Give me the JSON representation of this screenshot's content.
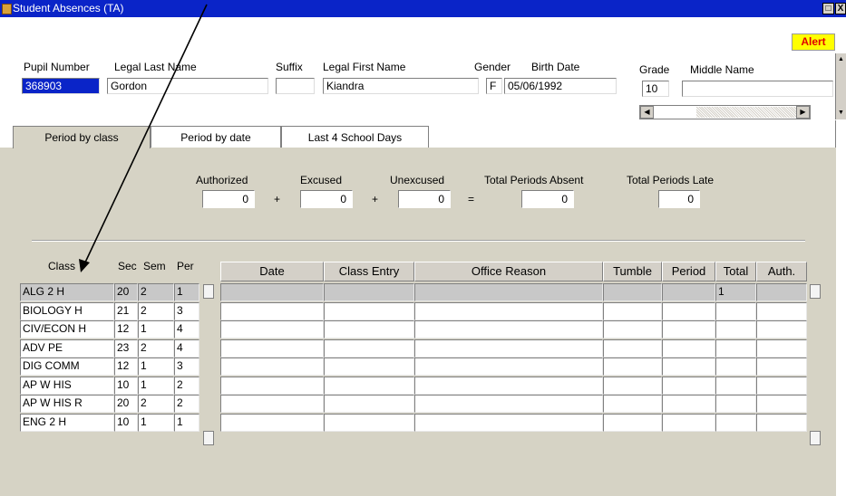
{
  "window": {
    "title": "Student Absences (TA)",
    "controls": [
      "□",
      "X"
    ]
  },
  "alert": {
    "label": "Alert",
    "color": "#ff0000",
    "background": "#ffff00"
  },
  "student": {
    "labels": {
      "pupil_number": "Pupil Number",
      "last_name": "Legal Last Name",
      "suffix": "Suffix",
      "first_name": "Legal First Name",
      "gender": "Gender",
      "birth_date": "Birth Date",
      "grade": "Grade",
      "middle_name": "Middle Name"
    },
    "values": {
      "pupil_number": "368903",
      "last_name": "Gordon",
      "suffix": "",
      "first_name": "Kiandra",
      "gender": "F",
      "birth_date": "05/06/1992",
      "grade": "10",
      "middle_name": ""
    }
  },
  "tabs": [
    "Period by class",
    "Period by date",
    "Last 4 School Days"
  ],
  "summary": {
    "labels": {
      "authorized": "Authorized",
      "excused": "Excused",
      "unexcused": "Unexcused",
      "total_absent": "Total Periods Absent",
      "total_late": "Total Periods Late"
    },
    "operators": [
      "+",
      "+",
      "="
    ],
    "values": {
      "authorized": "0",
      "excused": "0",
      "unexcused": "0",
      "total_absent": "0",
      "total_late": "0"
    }
  },
  "class_list": {
    "headers": {
      "class": "Class",
      "sec": "Sec",
      "sem": "Sem",
      "per": "Per"
    },
    "rows": [
      {
        "class": "ALG 2 H",
        "sec": "20",
        "sem": "2",
        "per": "1"
      },
      {
        "class": "BIOLOGY H",
        "sec": "21",
        "sem": "2",
        "per": "3"
      },
      {
        "class": "CIV/ECON H",
        "sec": "12",
        "sem": "1",
        "per": "4"
      },
      {
        "class": "ADV PE",
        "sec": "23",
        "sem": "2",
        "per": "4"
      },
      {
        "class": "DIG COMM",
        "sec": "12",
        "sem": "1",
        "per": "3"
      },
      {
        "class": "AP W HIS",
        "sec": "10",
        "sem": "1",
        "per": "2"
      },
      {
        "class": "AP W HIS R",
        "sec": "20",
        "sem": "2",
        "per": "2"
      },
      {
        "class": "ENG 2 H",
        "sec": "10",
        "sem": "1",
        "per": "1"
      }
    ]
  },
  "absences": {
    "headers": [
      "Date",
      "Class Entry",
      "Office Reason",
      "Tumble",
      "Period",
      "Total",
      "Auth."
    ],
    "rows": [
      [
        "",
        "",
        "",
        "",
        "",
        "1",
        ""
      ],
      [
        "",
        "",
        "",
        "",
        "",
        "",
        ""
      ],
      [
        "",
        "",
        "",
        "",
        "",
        "",
        ""
      ],
      [
        "",
        "",
        "",
        "",
        "",
        "",
        ""
      ],
      [
        "",
        "",
        "",
        "",
        "",
        "",
        ""
      ],
      [
        "",
        "",
        "",
        "",
        "",
        "",
        ""
      ],
      [
        "",
        "",
        "",
        "",
        "",
        "",
        ""
      ],
      [
        "",
        "",
        "",
        "",
        "",
        "",
        ""
      ]
    ]
  }
}
